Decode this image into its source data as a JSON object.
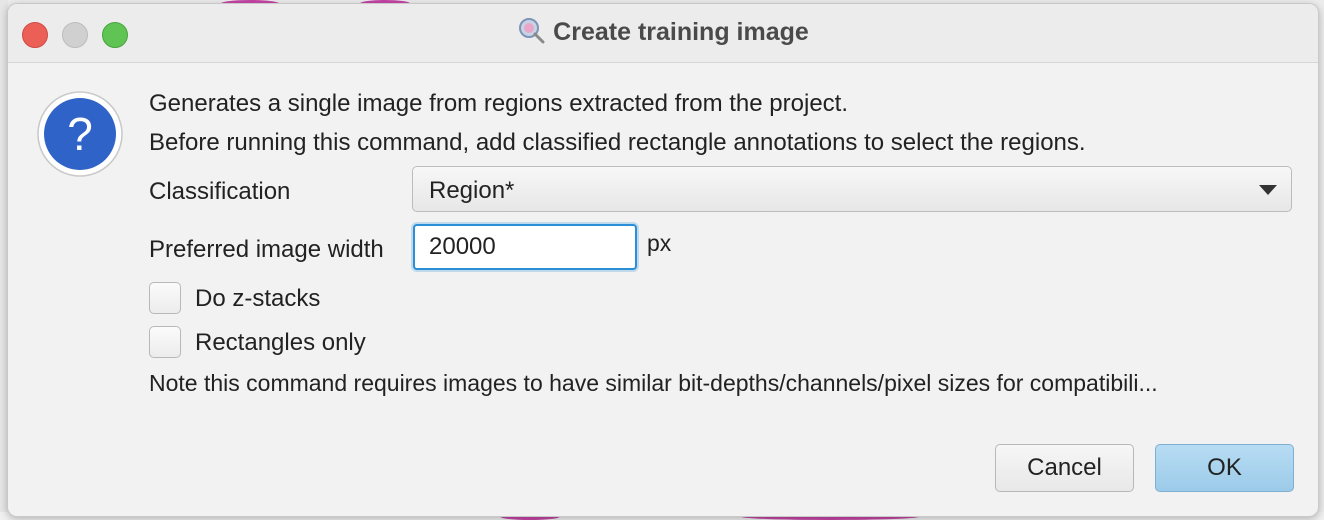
{
  "window": {
    "title": "Create training image"
  },
  "message": {
    "line1": "Generates a single image from regions extracted from the project.",
    "line2": "Before running this command, add classified rectangle annotations to select the regions."
  },
  "form": {
    "classification_label": "Classification",
    "classification_value": "Region*",
    "width_label": "Preferred image width",
    "width_value": "20000",
    "width_units": "px",
    "zstacks_label": "Do z-stacks",
    "zstacks_checked": false,
    "rectangles_label": "Rectangles only",
    "rectangles_checked": false,
    "note": "Note this command requires images to have similar bit-depths/channels/pixel sizes for compatibili..."
  },
  "buttons": {
    "cancel": "Cancel",
    "ok": "OK"
  },
  "colors": {
    "accent": "#2a8fd6",
    "default_button": "#a9d3ee",
    "question_icon": "#2f63c8"
  }
}
